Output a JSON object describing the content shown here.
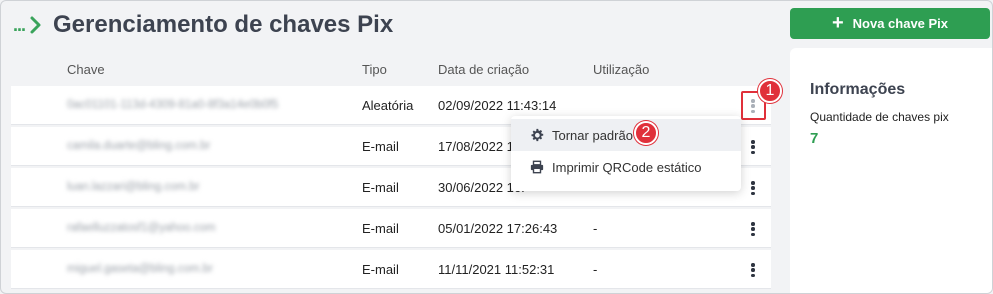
{
  "header": {
    "breadcrumb_dots": "...",
    "title": "Gerenciamento de chaves Pix",
    "new_key_button": "Nova chave Pix"
  },
  "table": {
    "columns": [
      "Chave",
      "Tipo",
      "Data de criação",
      "Utilização"
    ],
    "rows": [
      {
        "chave": "0ac01101-113d-4309-81a0-8f3a14e0b0f5",
        "tipo": "Aleatória",
        "data": "02/09/2022 11:43:14",
        "utilizacao": ""
      },
      {
        "chave": "camila.duarte@bling.com.br",
        "tipo": "E-mail",
        "data": "17/08/2022 16:",
        "utilizacao": ""
      },
      {
        "chave": "luan.lazzari@bling.com.br",
        "tipo": "E-mail",
        "data": "30/06/2022 16:",
        "utilizacao": ""
      },
      {
        "chave": "rafaelluzzatosf1@yahoo.com",
        "tipo": "E-mail",
        "data": "05/01/2022 17:26:43",
        "utilizacao": "-"
      },
      {
        "chave": "miguel.gaseta@bling.com.br",
        "tipo": "E-mail",
        "data": "11/11/2021 11:52:31",
        "utilizacao": "-"
      }
    ]
  },
  "dropdown": {
    "items": [
      {
        "label": "Tornar padrão",
        "icon": "gear-icon"
      },
      {
        "label": "Imprimir QRCode estático",
        "icon": "printer-icon"
      }
    ]
  },
  "callouts": {
    "first": "1",
    "second": "2"
  },
  "info_panel": {
    "title": "Informações",
    "label": "Quantidade de chaves pix",
    "value": "7"
  },
  "colors": {
    "brand_green": "#2e9e52",
    "callout_red": "#e0303a",
    "title_text": "#3d4350"
  }
}
